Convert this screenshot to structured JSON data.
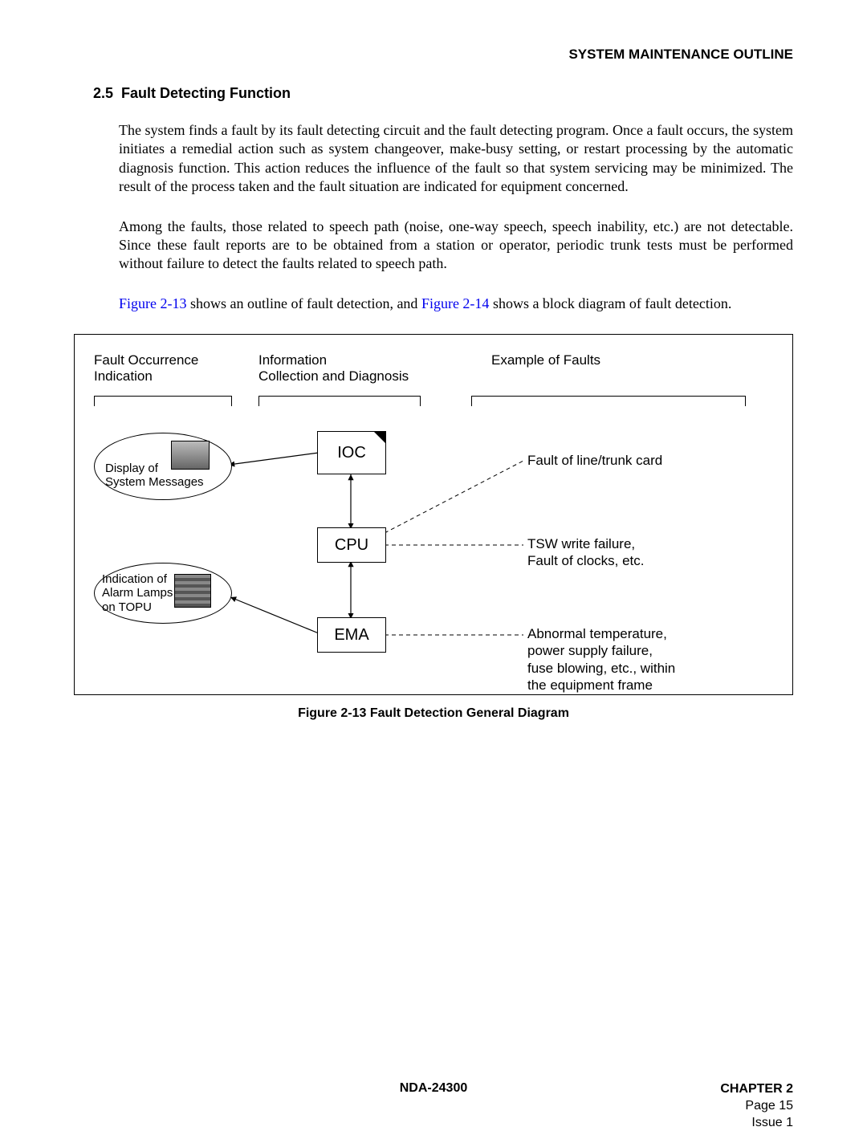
{
  "header": {
    "running": "SYSTEM MAINTENANCE OUTLINE"
  },
  "section": {
    "number": "2.5",
    "title": "Fault Detecting Function"
  },
  "paras": {
    "p1": "The system finds a fault by its fault detecting circuit and the fault detecting program. Once a fault occurs, the system initiates a remedial action such as system changeover, make-busy setting, or restart processing by the automatic diagnosis function. This action reduces the influence of the fault so that system servicing may be minimized. The result of the process taken and the fault situation are indicated for equipment concerned.",
    "p2": "Among the faults, those related to speech path (noise, one-way speech, speech inability, etc.) are not detectable. Since these fault reports are to be obtained from a station or operator, periodic trunk tests must be performed without failure to detect the faults related to speech path.",
    "p3_pre": " shows an outline of fault detection, and ",
    "p3_post": " shows a block diagram of fault detection.",
    "ref1": "Figure 2-13",
    "ref2": "Figure 2-14"
  },
  "diagram": {
    "columns": {
      "c1a": "Fault Occurrence",
      "c1b": "Indication",
      "c2a": "Information",
      "c2b": "Collection and Diagnosis",
      "c3": "Example of Faults"
    },
    "nodes": {
      "ioc": "IOC",
      "cpu": "CPU",
      "ema": "EMA"
    },
    "ellipses": {
      "e1a": "Display of",
      "e1b": "System Messages",
      "e2a": "Indication of",
      "e2b": "Alarm Lamps",
      "e2c": "on TOPU"
    },
    "faults": {
      "f1": "Fault of line/trunk card",
      "f2a": "TSW write failure,",
      "f2b": "Fault of clocks, etc.",
      "f3a": "Abnormal temperature,",
      "f3b": "power supply failure,",
      "f3c": "fuse blowing, etc., within",
      "f3d": "the equipment frame"
    },
    "caption": "Figure 2-13   Fault Detection General Diagram"
  },
  "footer": {
    "docnum": "NDA-24300",
    "chapter": "CHAPTER 2",
    "page": "Page 15",
    "issue": "Issue 1"
  }
}
